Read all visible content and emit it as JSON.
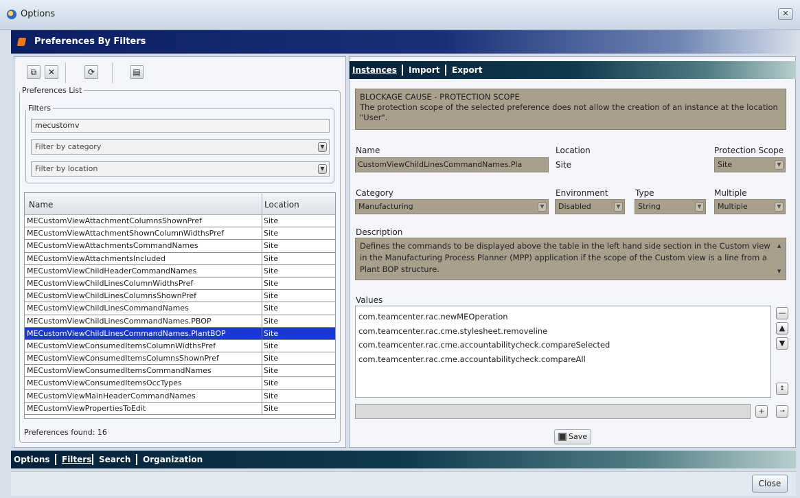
{
  "window": {
    "title": "Options",
    "close_label": "✕"
  },
  "banner": {
    "title": "Preferences By Filters"
  },
  "toolbar": {
    "icons": [
      "copy-icon",
      "delete-icon",
      "refresh-icon",
      "export-icon"
    ]
  },
  "prefs": {
    "group_label": "Preferences List",
    "filters_label": "Filters",
    "filter_text": "mecustomv",
    "category_placeholder": "Filter by category",
    "location_placeholder": "Filter by location",
    "columns": [
      "Name",
      "Location"
    ],
    "rows": [
      [
        "MECustomViewAttachmentColumnsShownPref",
        "Site"
      ],
      [
        "MECustomViewAttachmentShownColumnWidthsPref",
        "Site"
      ],
      [
        "MECustomViewAttachmentsCommandNames",
        "Site"
      ],
      [
        "MECustomViewAttachmentsIncluded",
        "Site"
      ],
      [
        "MECustomViewChildHeaderCommandNames",
        "Site"
      ],
      [
        "MECustomViewChildLinesColumnWidthsPref",
        "Site"
      ],
      [
        "MECustomViewChildLinesColumnsShownPref",
        "Site"
      ],
      [
        "MECustomViewChildLinesCommandNames",
        "Site"
      ],
      [
        "MECustomViewChildLinesCommandNames.PBOP",
        "Site"
      ],
      [
        "MECustomViewChildLinesCommandNames.PlantBOP",
        "Site"
      ],
      [
        "MECustomViewConsumedItemsColumnWidthsPref",
        "Site"
      ],
      [
        "MECustomViewConsumedItemsColumnsShownPref",
        "Site"
      ],
      [
        "MECustomViewConsumedItemsCommandNames",
        "Site"
      ],
      [
        "MECustomViewConsumedItemsOccTypes",
        "Site"
      ],
      [
        "MECustomViewMainHeaderCommandNames",
        "Site"
      ],
      [
        "MECustomViewPropertiesToEdit",
        "Site"
      ]
    ],
    "selected_index": 9,
    "found": "Preferences found: 16"
  },
  "tabs": [
    "Instances",
    "Import",
    "Export"
  ],
  "blockage": {
    "title": "BLOCKAGE CAUSE - PROTECTION SCOPE",
    "text": "The protection scope of the selected preference does not allow the creation of an instance at the location \"User\"."
  },
  "detail": {
    "name_label": "Name",
    "name_value": "CustomViewChildLinesCommandNames.Pla",
    "location_label": "Location",
    "location_value": "Site",
    "scope_label": "Protection Scope",
    "scope_value": "Site",
    "category_label": "Category",
    "category_value": "Manufacturing",
    "env_label": "Environment",
    "env_value": "Disabled",
    "type_label": "Type",
    "type_value": "String",
    "multiple_label": "Multiple",
    "multiple_value": "Multiple",
    "desc_label": "Description",
    "desc_text": "Defines the commands to be displayed above the table in the left hand side section in the Custom view in the Manufacturing Process Planner (MPP) application if the scope of the Custom view is a line from a Plant BOP structure.",
    "values_label": "Values",
    "values": [
      "com.teamcenter.rac.newMEOperation",
      "com.teamcenter.rac.cme.stylesheet.removeline",
      "com.teamcenter.rac.cme.accountabilitycheck.compareSelected",
      "com.teamcenter.rac.cme.accountabilitycheck.compareAll"
    ],
    "save_label": "Save"
  },
  "nav": [
    "Options",
    "Filters",
    "Search",
    "Organization"
  ],
  "footer": {
    "close_label": "Close"
  },
  "colors": {
    "selection": "#1a39d4",
    "disabled_field": "#a89f8c",
    "banner": "#0c1f63"
  }
}
